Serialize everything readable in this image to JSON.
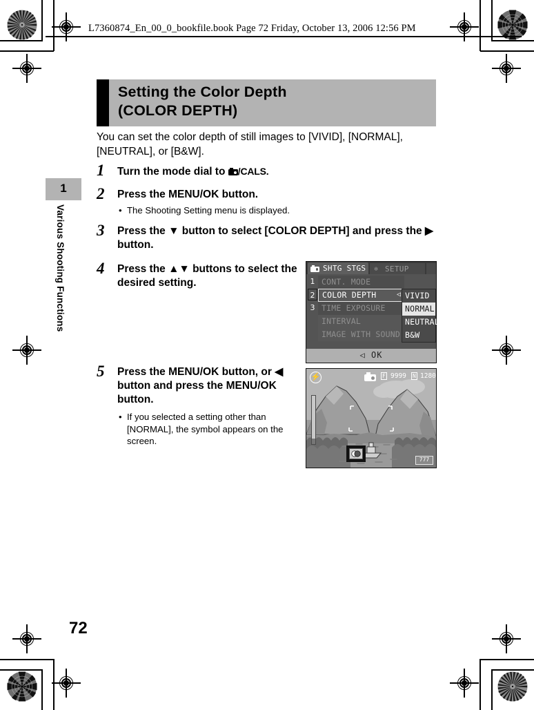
{
  "runhead": {
    "text": "L7360874_En_00_0_bookfile.book  Page 72  Friday, October 13, 2006  12:56 PM"
  },
  "title": {
    "line1": "Setting the Color Depth",
    "line2": "(COLOR DEPTH)"
  },
  "intro": "You can set the color depth of still images to [VIVID], [NORMAL], [NEUTRAL], or [B&W].",
  "steps": [
    {
      "num": "1",
      "text_before": "Turn the mode dial to ",
      "icon": "camera-icon",
      "text_after": "/CALS."
    },
    {
      "num": "2",
      "text": "Press the MENU/OK button.",
      "bullets": [
        "The Shooting Setting menu is displayed."
      ]
    },
    {
      "num": "3",
      "text": "Press the ▼ button to select [COLOR DEPTH] and press the ▶ button."
    },
    {
      "num": "4",
      "text": "Press the ▲▼ buttons to select the desired setting."
    },
    {
      "num": "5",
      "text": "Press the MENU/OK button, or ◀ button and press the MENU/OK button.",
      "bullets": [
        "If you selected a setting other than [NORMAL], the symbol appears on the screen."
      ]
    }
  ],
  "sidebar": {
    "chapter_number": "1",
    "chapter_title": "Various Shooting Functions"
  },
  "page_number": "72",
  "lcd_menu": {
    "tab_active": "SHTG STGS",
    "tab_inactive": "SETUP",
    "page_numbers": [
      "1",
      "2",
      "3"
    ],
    "selected_page": "2",
    "items": [
      "CONT. MODE",
      "COLOR DEPTH",
      "TIME EXPOSURE",
      "INTERVAL",
      "IMAGE WITH SOUND"
    ],
    "selected_item": "COLOR DEPTH",
    "submenu_options": [
      "VIVID",
      "NORMAL",
      "NEUTRAL",
      "B&W"
    ],
    "submenu_highlighted": "NORMAL",
    "footer": "◁ OK"
  },
  "lcd_preview": {
    "flash_icon": "flash-off-icon",
    "mode_icon": "still-camera-icon",
    "quality_badge": "F",
    "shots_remaining": "9999",
    "picture_quality": "N",
    "image_size": "1280",
    "card_label": "777",
    "symbol_overlay": "color-depth-symbol"
  },
  "colors": {
    "title_band": "#b3b3b3",
    "title_rule": "#000000",
    "lcd_background": "#545454",
    "highlight": "#e6e6e6"
  }
}
